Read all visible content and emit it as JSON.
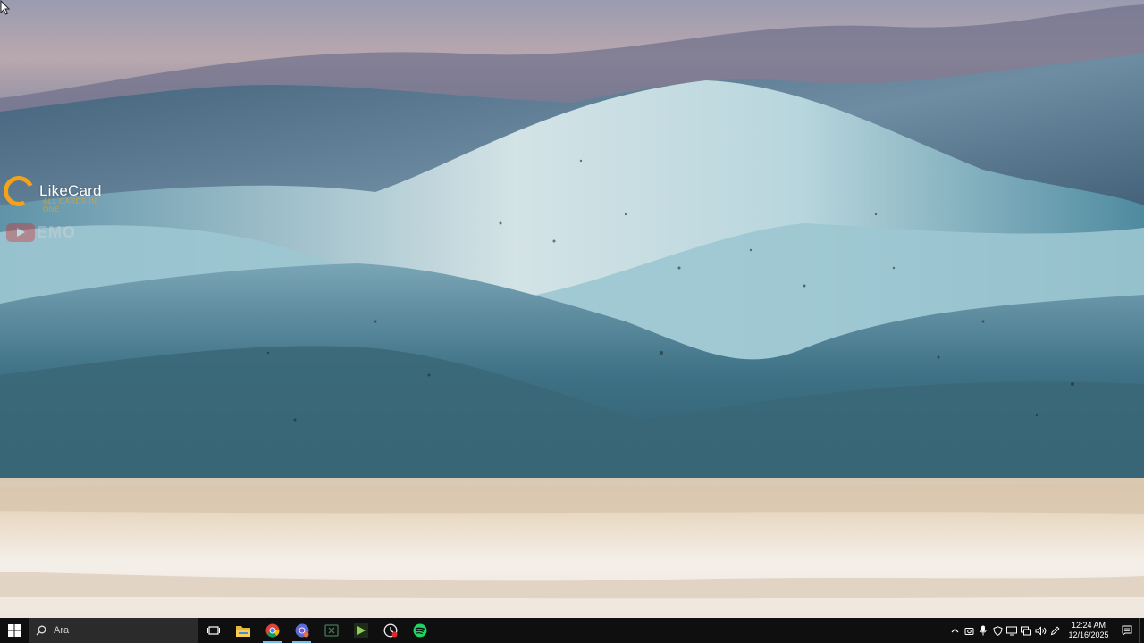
{
  "desktop": {
    "watermark_brand": "LikeCard",
    "watermark_tagline": "ALL CARDS IN ONE",
    "watermark_channel": "EMO"
  },
  "taskbar": {
    "search_placeholder": "Ara",
    "pinned": [
      {
        "name": "task-view",
        "icon": "task-view-icon"
      },
      {
        "name": "file-explorer",
        "icon": "folder-icon"
      },
      {
        "name": "chrome",
        "icon": "chrome-icon"
      },
      {
        "name": "chrome-profile",
        "icon": "chrome-profile-icon"
      },
      {
        "name": "excel",
        "icon": "spreadsheet-icon"
      },
      {
        "name": "android-studio",
        "icon": "play-app-icon"
      },
      {
        "name": "obs",
        "icon": "record-app-icon"
      },
      {
        "name": "spotify",
        "icon": "spotify-icon"
      }
    ],
    "clock_time": "12:24 AM",
    "clock_date": "12/16/2025"
  },
  "colors": {
    "taskbar_bg": "#0f0f10",
    "accent": "#76b9ed",
    "brand_orange": "#f3a21c"
  }
}
